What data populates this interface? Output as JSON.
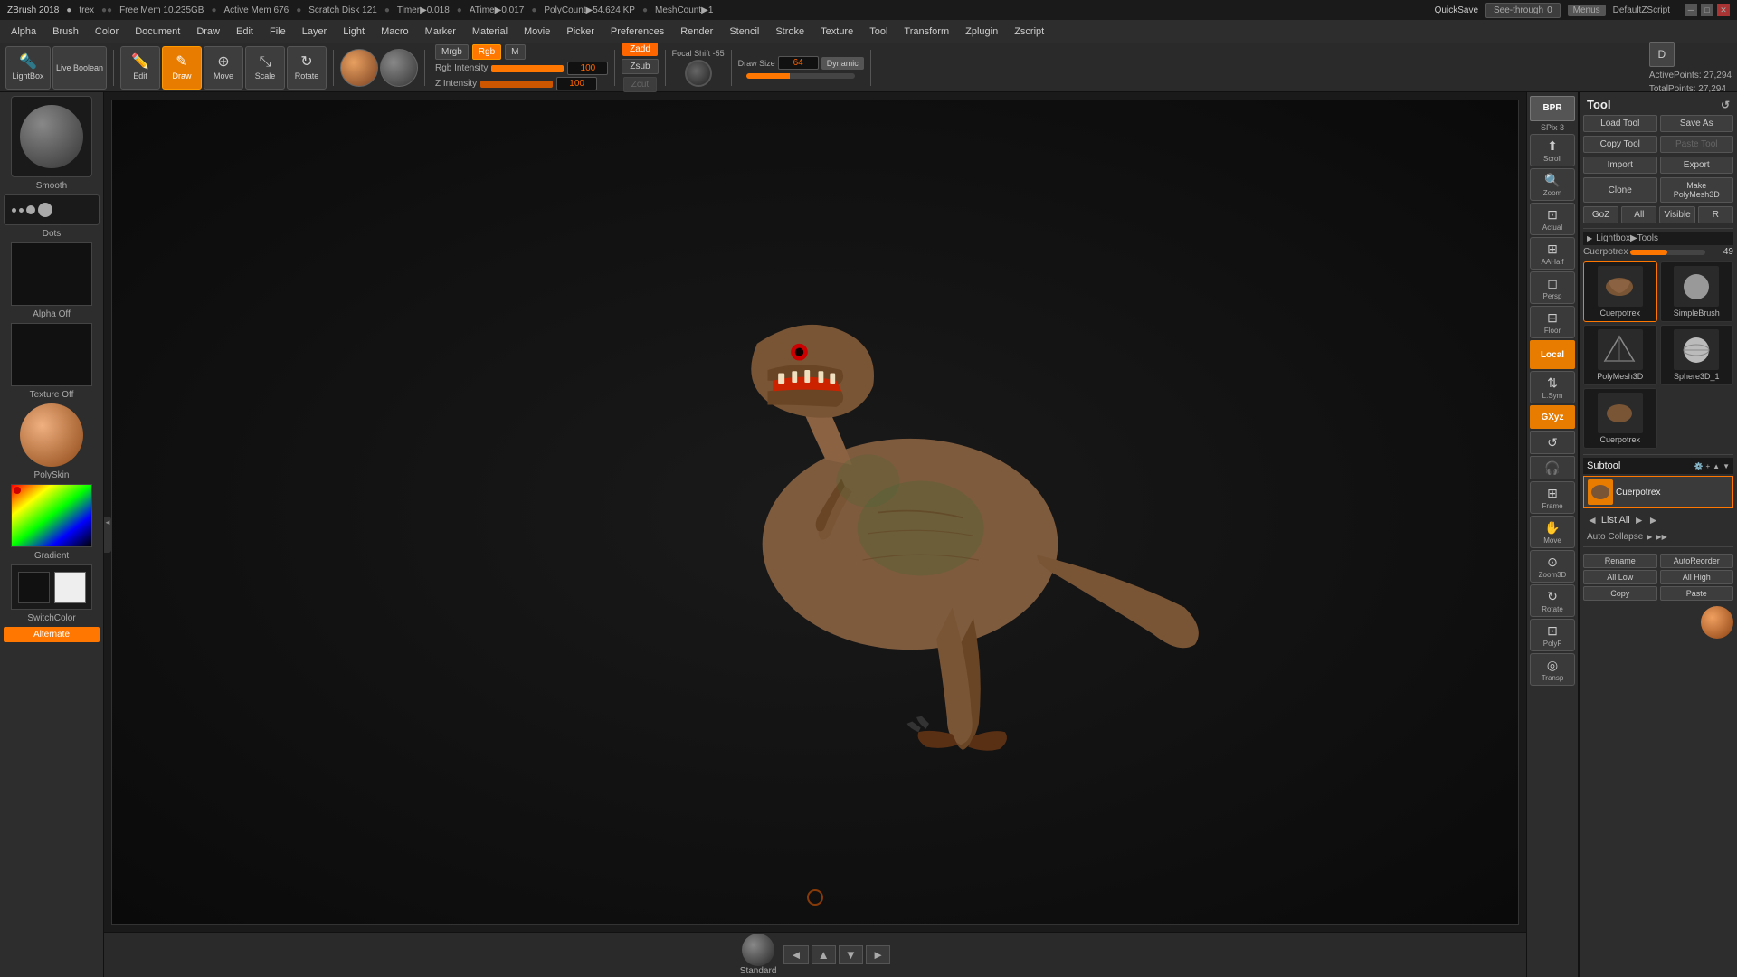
{
  "title_bar": {
    "app_name": "ZBrush 2018",
    "username": "trex",
    "free_mem": "Free Mem 10.235GB",
    "active_mem": "Active Mem 676",
    "scratch_disk": "Scratch Disk 121",
    "timer": "Timer▶0.018",
    "atime": "ATime▶0.017",
    "poly_count": "PolyCount▶54.624 KP",
    "mesh_count": "MeshCount▶1",
    "quicksave": "QuickSave"
  },
  "menu_bar": {
    "items": [
      {
        "id": "alpha",
        "label": "Alpha"
      },
      {
        "id": "brush",
        "label": "Brush"
      },
      {
        "id": "color",
        "label": "Color"
      },
      {
        "id": "document",
        "label": "Document"
      },
      {
        "id": "draw",
        "label": "Draw"
      },
      {
        "id": "edit",
        "label": "Edit"
      },
      {
        "id": "file",
        "label": "File"
      },
      {
        "id": "layer",
        "label": "Layer"
      },
      {
        "id": "light",
        "label": "Light"
      },
      {
        "id": "macro",
        "label": "Macro"
      },
      {
        "id": "marker",
        "label": "Marker"
      },
      {
        "id": "material",
        "label": "Material"
      },
      {
        "id": "movie",
        "label": "Movie"
      },
      {
        "id": "picker",
        "label": "Picker"
      },
      {
        "id": "preferences",
        "label": "Preferences"
      },
      {
        "id": "render",
        "label": "Render"
      },
      {
        "id": "stencil",
        "label": "Stencil"
      },
      {
        "id": "stroke",
        "label": "Stroke"
      },
      {
        "id": "texture",
        "label": "Texture"
      },
      {
        "id": "tool",
        "label": "Tool"
      },
      {
        "id": "transform",
        "label": "Transform"
      },
      {
        "id": "zplugin",
        "label": "Zplugin"
      },
      {
        "id": "zscript",
        "label": "Zscript"
      }
    ]
  },
  "toolbar": {
    "edit_label": "Edit",
    "draw_label": "Draw",
    "move_label": "Move",
    "scale_label": "Scale",
    "rotate_label": "Rotate",
    "mrgb_label": "Mrgb",
    "rgb_label": "Rgb",
    "rgb_intensity_label": "Rgb Intensity",
    "rgb_intensity_value": "100",
    "z_intensity_label": "Z Intensity",
    "z_intensity_value": "100",
    "zadd_label": "Zadd",
    "zsub_label": "Zsub",
    "zcut_label": "Zcut",
    "focal_shift_label": "Focal Shift",
    "focal_shift_value": "-55",
    "draw_size_label": "Draw Size",
    "draw_size_value": "64",
    "dynamic_label": "Dynamic",
    "m_label": "M",
    "seethrough_label": "See-through",
    "seethrough_value": "0",
    "menus_label": "Menus",
    "default_zscript": "DefaultZScript"
  },
  "left_panel": {
    "lightbox_label": "LightBox",
    "live_boolean_label": "Live Boolean",
    "brush_label": "Smooth",
    "dots_label": "Dots",
    "alpha_label": "Alpha Off",
    "texture_label": "Texture Off",
    "material_label": "PolySkin",
    "gradient_label": "Gradient",
    "switchcolor_label": "SwitchColor",
    "alternate_label": "Alternate"
  },
  "viewport_controls": {
    "bpr_label": "BPR",
    "spix_label": "SPix  3",
    "scroll_label": "Scroll",
    "zoom_label": "Zoom",
    "actual_label": "Actual",
    "aahalf_label": "AAHalf",
    "persp_label": "Persp",
    "floor_label": "Floor",
    "local_label": "Local",
    "lsym_label": "L.Sym",
    "gxyz_label": "GXyz",
    "frame_label": "Frame",
    "move_label": "Move",
    "zoom3d_label": "Zoom3D",
    "rotate_label": "Rotate",
    "polyf_label": "PolyF",
    "transp_label": "Transp"
  },
  "right_panel": {
    "tool_title": "Tool",
    "load_tool": "Load Tool",
    "save_as": "Save As",
    "copy_tool": "Copy Tool",
    "paste_tool": "Paste Tool",
    "import": "Import",
    "export": "Export",
    "clone": "Clone",
    "make_polymesh3d": "Make PolyMesh3D",
    "goz": "GoZ",
    "all": "All",
    "visible": "Visible",
    "r_label": "R",
    "lightbox_tools": "Lightbox▶Tools",
    "cuerpotrex_value": "49",
    "cuerpotrex_label": "Cuerpotrex",
    "tools": [
      {
        "id": "cuerpotrex",
        "label": "Cuerpotrex",
        "selected": true
      },
      {
        "id": "simplebush",
        "label": "SimpleBrush"
      },
      {
        "id": "polymesh3d",
        "label": "PolyMesh3D"
      },
      {
        "id": "sphere3d_1",
        "label": "Sphere3D_1"
      },
      {
        "id": "cuerpotrex2",
        "label": "Cuerpotrex"
      }
    ],
    "subtool": "Subtool",
    "subtool_name": "Cuerpotrex",
    "list_all": "List All",
    "auto_collapse": "Auto Collapse",
    "rename": "Rename",
    "auto_reorder": "AutoReorder",
    "all_low": "All Low",
    "all_high": "All High",
    "copy_bottom": "Copy",
    "paste_bottom": "Paste"
  },
  "stats": {
    "active_points_label": "ActivePoints:",
    "active_points_value": "27,294",
    "total_points_label": "TotalPoints:",
    "total_points_value": "27,294"
  },
  "bottom": {
    "standard_label": "Standard"
  },
  "colors": {
    "accent": "#e87c00",
    "active_btn": "#e87c00",
    "text_primary": "#ccc",
    "bg_dark": "#1a1a1a",
    "bg_medium": "#2d2d2d",
    "bg_light": "#3d3d3d"
  }
}
